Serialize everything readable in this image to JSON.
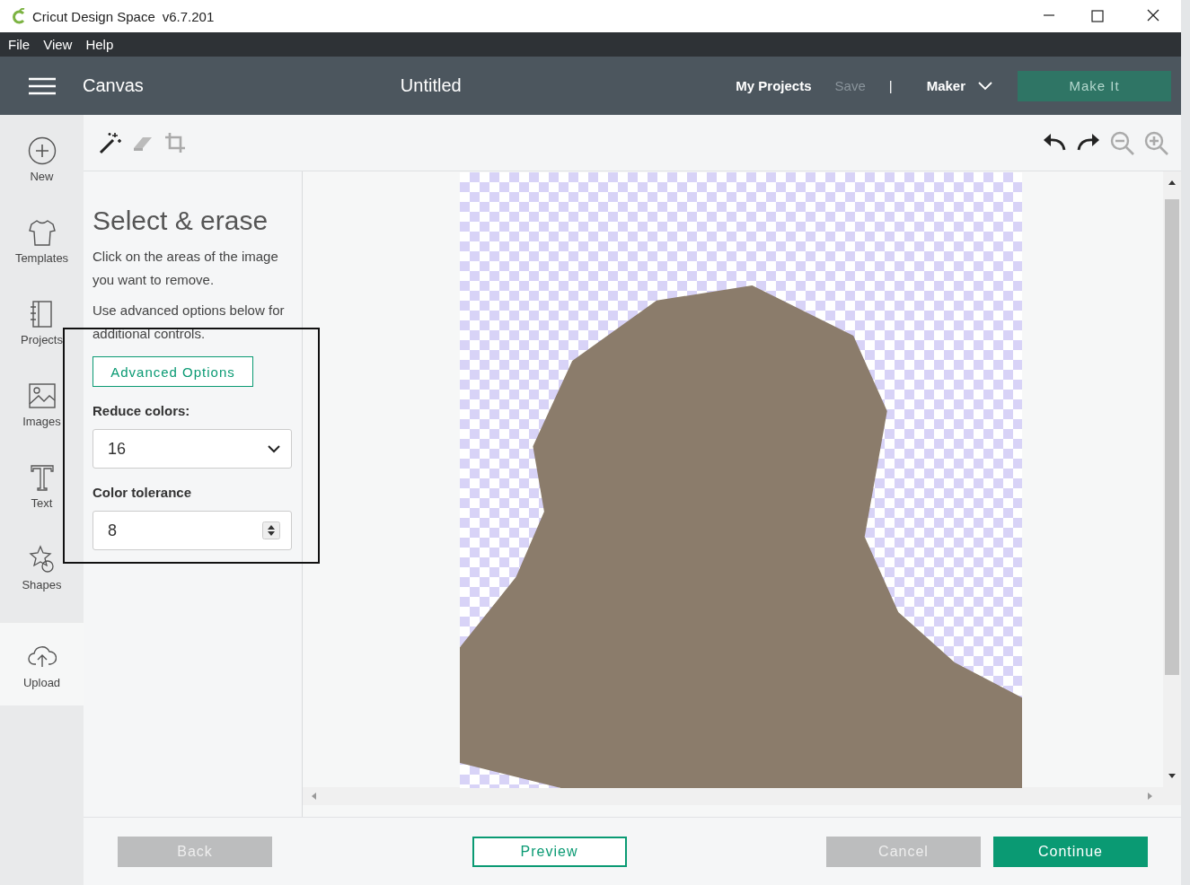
{
  "window": {
    "title": "Cricut Design Space",
    "version": "v6.7.201"
  },
  "menu": [
    "File",
    "View",
    "Help"
  ],
  "header": {
    "page": "Canvas",
    "project": "Untitled",
    "links": [
      {
        "label": "My Projects",
        "disabled": false
      },
      {
        "label": "Save",
        "disabled": true
      }
    ],
    "separator": "|",
    "machine": "Maker",
    "make_it": {
      "label": "Make It",
      "disabled": true
    }
  },
  "sidebar": {
    "items": [
      {
        "kind": "new",
        "label": "New",
        "selected": false
      },
      {
        "kind": "templates",
        "label": "Templates",
        "selected": false
      },
      {
        "kind": "projects",
        "label": "Projects",
        "selected": false
      },
      {
        "kind": "images",
        "label": "Images",
        "selected": false
      },
      {
        "kind": "text",
        "label": "Text",
        "selected": false
      },
      {
        "kind": "shapes",
        "label": "Shapes",
        "selected": false
      },
      {
        "kind": "upload",
        "label": "Upload",
        "selected": true
      }
    ]
  },
  "panel": {
    "title": "Select & erase",
    "paragraphs": [
      "Click on the areas of the image you want to remove.",
      "Use advanced options below for additional controls."
    ],
    "advanced_button": "Advanced Options",
    "reduce_colors": {
      "label": "Reduce colors:",
      "value": "16"
    },
    "color_tolerance": {
      "label": "Color tolerance",
      "value": "8"
    }
  },
  "footer": {
    "buttons": [
      {
        "kind": "back",
        "label": "Back",
        "disabled": true
      },
      {
        "kind": "preview",
        "label": "Preview",
        "disabled": false
      },
      {
        "kind": "cancel",
        "label": "Cancel",
        "disabled": true
      },
      {
        "kind": "continue",
        "label": "Continue",
        "disabled": false
      }
    ]
  }
}
